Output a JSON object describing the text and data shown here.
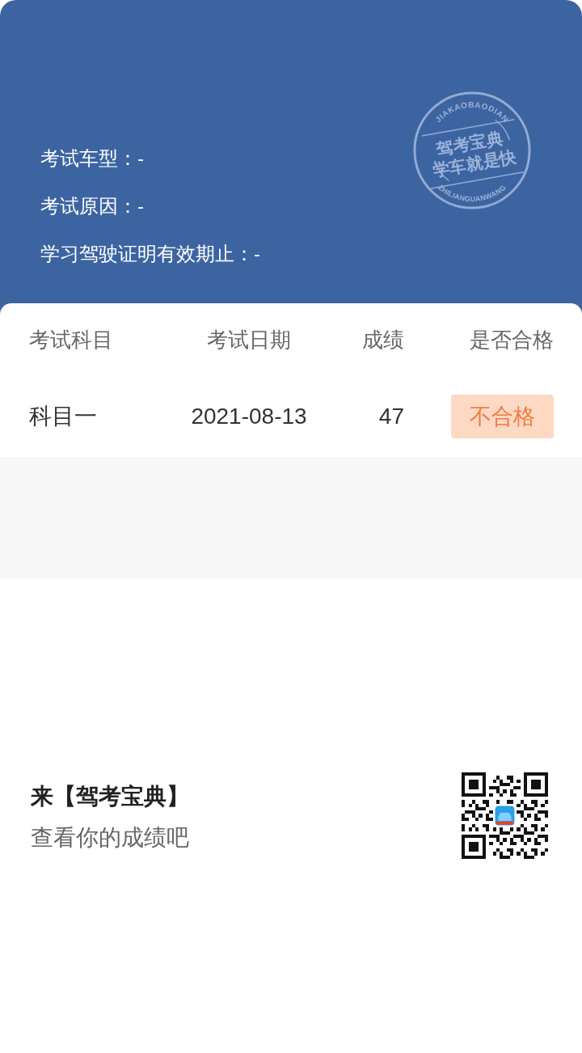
{
  "header": {
    "info_lines": [
      "考试车型：-",
      "考试原因：-",
      "学习驾驶证明有效期止：-"
    ],
    "stamp": {
      "arc_top": "JIAKAOBAODIAN",
      "line_1": "驾考宝典",
      "line_2": "学车就是快",
      "arc_bottom": "ZHILIANGUANWANG"
    }
  },
  "table": {
    "columns": [
      "考试科目",
      "考试日期",
      "成绩",
      "是否合格"
    ],
    "rows": [
      {
        "subject": "科目一",
        "date": "2021-08-13",
        "score": "47",
        "result": {
          "label": "不合格",
          "passed": false
        }
      }
    ]
  },
  "footer": {
    "title": "来【驾考宝典】",
    "subtitle": "查看你的成绩吧"
  }
}
